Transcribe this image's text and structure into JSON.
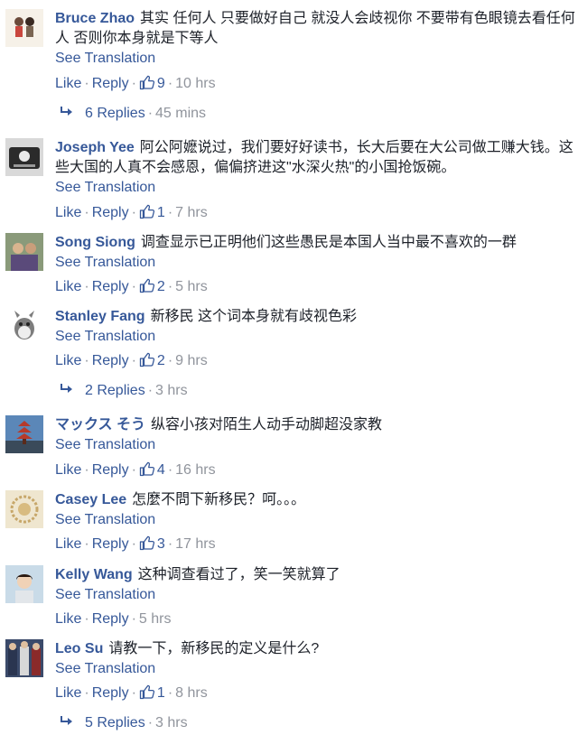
{
  "labels": {
    "see_translation": "See Translation",
    "like": "Like",
    "reply": "Reply",
    "dot": "·"
  },
  "comments": [
    {
      "author": "Bruce Zhao",
      "text": "其实 任何人 只要做好自己 就没人会歧视你 不要带有色眼镜去看任何人 否则你本身就是下等人",
      "likes": "9",
      "time": "10 hrs",
      "replies": "6 Replies",
      "replies_time": "45 mins"
    },
    {
      "author": "Joseph Yee",
      "text": "阿公阿嬷说过，我们要好好读书，长大后要在大公司做工赚大钱。这些大国的人真不会感恩，偏偏挤进这\"水深火热\"的小国抢饭碗。",
      "likes": "1",
      "time": "7 hrs"
    },
    {
      "author": "Song Siong",
      "text": "调查显示已正明他们这些愚民是本国人当中最不喜欢的一群",
      "likes": "2",
      "time": "5 hrs"
    },
    {
      "author": "Stanley Fang",
      "text": "新移民 这个词本身就有歧视色彩",
      "likes": "2",
      "time": "9 hrs",
      "replies": "2 Replies",
      "replies_time": "3 hrs"
    },
    {
      "author": "マックス そう",
      "text": "纵容小孩对陌生人动手动脚超没家教",
      "likes": "4",
      "time": "16 hrs"
    },
    {
      "author": "Casey Lee",
      "text": "怎麼不問下新移民？呵。。。",
      "likes": "3",
      "time": "17 hrs"
    },
    {
      "author": "Kelly Wang",
      "text": "这种调查看过了，笑一笑就算了",
      "likes": "",
      "time": "5 hrs"
    },
    {
      "author": "Leo Su",
      "text": "请教一下，新移民的定义是什么?",
      "likes": "1",
      "time": "8 hrs",
      "replies": "5 Replies",
      "replies_time": "3 hrs"
    }
  ],
  "colors": {
    "link": "#365899",
    "meta": "#90949c",
    "text": "#1d2129"
  }
}
